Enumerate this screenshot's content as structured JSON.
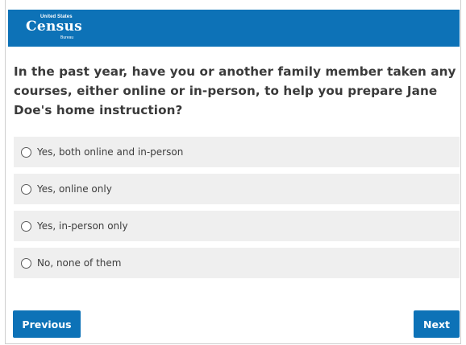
{
  "header": {
    "logo_top": "United States",
    "logo_main": "Census",
    "logo_bottom": "Bureau",
    "background_color": "#0d72b7"
  },
  "question": {
    "text": "In the past year, have you or another family member taken any courses, either online or in-person, to help you prepare Jane Doe's home instruction?"
  },
  "options": [
    {
      "label": "Yes, both online and in-person",
      "selected": false
    },
    {
      "label": "Yes, online only",
      "selected": false
    },
    {
      "label": "Yes, in-person only",
      "selected": false
    },
    {
      "label": "No, none of them",
      "selected": false
    }
  ],
  "navigation": {
    "previous_label": "Previous",
    "next_label": "Next"
  }
}
